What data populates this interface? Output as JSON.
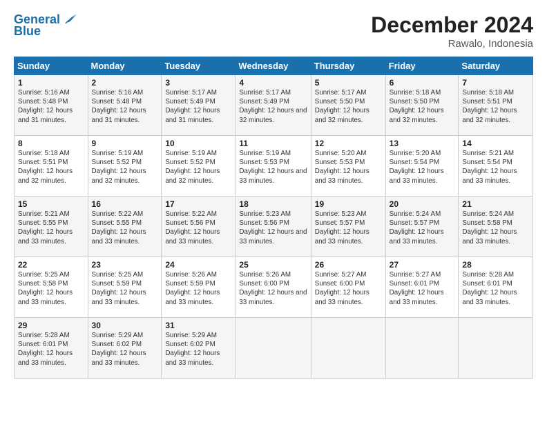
{
  "header": {
    "logo_line1": "General",
    "logo_line2": "Blue",
    "month_title": "December 2024",
    "location": "Rawalo, Indonesia"
  },
  "weekdays": [
    "Sunday",
    "Monday",
    "Tuesday",
    "Wednesday",
    "Thursday",
    "Friday",
    "Saturday"
  ],
  "weeks": [
    [
      {
        "day": "1",
        "sunrise": "5:16 AM",
        "sunset": "5:48 PM",
        "daylight": "12 hours and 31 minutes."
      },
      {
        "day": "2",
        "sunrise": "5:16 AM",
        "sunset": "5:48 PM",
        "daylight": "12 hours and 31 minutes."
      },
      {
        "day": "3",
        "sunrise": "5:17 AM",
        "sunset": "5:49 PM",
        "daylight": "12 hours and 31 minutes."
      },
      {
        "day": "4",
        "sunrise": "5:17 AM",
        "sunset": "5:49 PM",
        "daylight": "12 hours and 32 minutes."
      },
      {
        "day": "5",
        "sunrise": "5:17 AM",
        "sunset": "5:50 PM",
        "daylight": "12 hours and 32 minutes."
      },
      {
        "day": "6",
        "sunrise": "5:18 AM",
        "sunset": "5:50 PM",
        "daylight": "12 hours and 32 minutes."
      },
      {
        "day": "7",
        "sunrise": "5:18 AM",
        "sunset": "5:51 PM",
        "daylight": "12 hours and 32 minutes."
      }
    ],
    [
      {
        "day": "8",
        "sunrise": "5:18 AM",
        "sunset": "5:51 PM",
        "daylight": "12 hours and 32 minutes."
      },
      {
        "day": "9",
        "sunrise": "5:19 AM",
        "sunset": "5:52 PM",
        "daylight": "12 hours and 32 minutes."
      },
      {
        "day": "10",
        "sunrise": "5:19 AM",
        "sunset": "5:52 PM",
        "daylight": "12 hours and 32 minutes."
      },
      {
        "day": "11",
        "sunrise": "5:19 AM",
        "sunset": "5:53 PM",
        "daylight": "12 hours and 33 minutes."
      },
      {
        "day": "12",
        "sunrise": "5:20 AM",
        "sunset": "5:53 PM",
        "daylight": "12 hours and 33 minutes."
      },
      {
        "day": "13",
        "sunrise": "5:20 AM",
        "sunset": "5:54 PM",
        "daylight": "12 hours and 33 minutes."
      },
      {
        "day": "14",
        "sunrise": "5:21 AM",
        "sunset": "5:54 PM",
        "daylight": "12 hours and 33 minutes."
      }
    ],
    [
      {
        "day": "15",
        "sunrise": "5:21 AM",
        "sunset": "5:55 PM",
        "daylight": "12 hours and 33 minutes."
      },
      {
        "day": "16",
        "sunrise": "5:22 AM",
        "sunset": "5:55 PM",
        "daylight": "12 hours and 33 minutes."
      },
      {
        "day": "17",
        "sunrise": "5:22 AM",
        "sunset": "5:56 PM",
        "daylight": "12 hours and 33 minutes."
      },
      {
        "day": "18",
        "sunrise": "5:23 AM",
        "sunset": "5:56 PM",
        "daylight": "12 hours and 33 minutes."
      },
      {
        "day": "19",
        "sunrise": "5:23 AM",
        "sunset": "5:57 PM",
        "daylight": "12 hours and 33 minutes."
      },
      {
        "day": "20",
        "sunrise": "5:24 AM",
        "sunset": "5:57 PM",
        "daylight": "12 hours and 33 minutes."
      },
      {
        "day": "21",
        "sunrise": "5:24 AM",
        "sunset": "5:58 PM",
        "daylight": "12 hours and 33 minutes."
      }
    ],
    [
      {
        "day": "22",
        "sunrise": "5:25 AM",
        "sunset": "5:58 PM",
        "daylight": "12 hours and 33 minutes."
      },
      {
        "day": "23",
        "sunrise": "5:25 AM",
        "sunset": "5:59 PM",
        "daylight": "12 hours and 33 minutes."
      },
      {
        "day": "24",
        "sunrise": "5:26 AM",
        "sunset": "5:59 PM",
        "daylight": "12 hours and 33 minutes."
      },
      {
        "day": "25",
        "sunrise": "5:26 AM",
        "sunset": "6:00 PM",
        "daylight": "12 hours and 33 minutes."
      },
      {
        "day": "26",
        "sunrise": "5:27 AM",
        "sunset": "6:00 PM",
        "daylight": "12 hours and 33 minutes."
      },
      {
        "day": "27",
        "sunrise": "5:27 AM",
        "sunset": "6:01 PM",
        "daylight": "12 hours and 33 minutes."
      },
      {
        "day": "28",
        "sunrise": "5:28 AM",
        "sunset": "6:01 PM",
        "daylight": "12 hours and 33 minutes."
      }
    ],
    [
      {
        "day": "29",
        "sunrise": "5:28 AM",
        "sunset": "6:01 PM",
        "daylight": "12 hours and 33 minutes."
      },
      {
        "day": "30",
        "sunrise": "5:29 AM",
        "sunset": "6:02 PM",
        "daylight": "12 hours and 33 minutes."
      },
      {
        "day": "31",
        "sunrise": "5:29 AM",
        "sunset": "6:02 PM",
        "daylight": "12 hours and 33 minutes."
      },
      null,
      null,
      null,
      null
    ]
  ]
}
